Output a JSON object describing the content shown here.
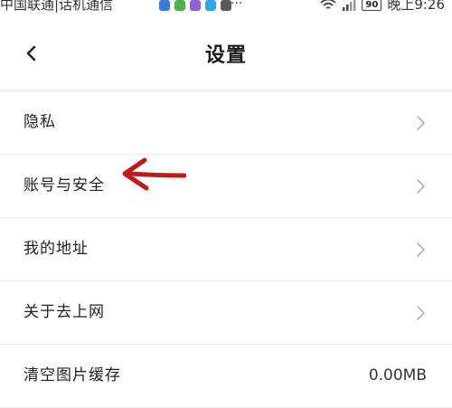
{
  "status_bar": {
    "carrier": "中国联通|话机通信",
    "more": "···",
    "battery": "90",
    "time": "晚上9:26",
    "app_badge_colors": [
      "#3a7bd5",
      "#4cb050",
      "#8f5fd6",
      "#2fa6e6",
      "#5a5a5a"
    ]
  },
  "header": {
    "title": "设置",
    "back_icon": "chevron-left-icon"
  },
  "settings": {
    "items": [
      {
        "label": "隐私",
        "icon": "chevron-right-icon"
      },
      {
        "label": "账号与安全",
        "icon": "chevron-right-icon"
      },
      {
        "label": "我的地址",
        "icon": "chevron-right-icon"
      },
      {
        "label": "关于去上网",
        "icon": "chevron-right-icon"
      },
      {
        "label": "清空图片缓存",
        "value": "0.00MB"
      }
    ]
  },
  "annotation": {
    "color": "#c0191a",
    "icon": "red-arrow-icon"
  }
}
